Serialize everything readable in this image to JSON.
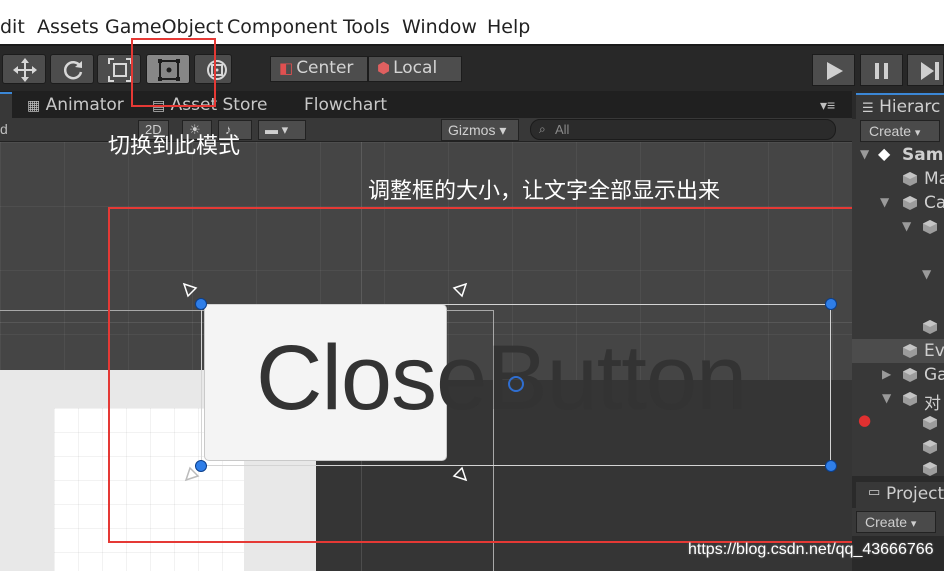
{
  "menu": [
    "dit",
    "Assets",
    "GameObject",
    "Component",
    "Tools",
    "Window",
    "Help"
  ],
  "toolbar": {
    "tools": [
      "move-tool",
      "rotate-tool",
      "scale-tool",
      "rect-tool",
      "transform-tool"
    ],
    "active_tool": "rect-tool",
    "pivot_center": "Center",
    "pivot_local": "Local"
  },
  "tabs": {
    "animator": "Animator",
    "asset_store": "Asset Store",
    "flowchart": "Flowchart"
  },
  "scene_toolbar": {
    "left_stub": "d",
    "mode_2d": "2D",
    "gizmos": "Gizmos",
    "gizmos_arrow": "▾",
    "search_placeholder": "All"
  },
  "scene": {
    "button_text": "CloseButton"
  },
  "annotations": {
    "switch_mode": "切换到此模式",
    "resize_hint": "调整框的大小，让文字全部显示出来"
  },
  "hierarchy": {
    "tab_label": "Hierarc",
    "create_label": "Create",
    "create_arrow": "▾",
    "rows": [
      {
        "label": "Sam",
        "bold": true
      },
      {
        "label": "Ma"
      },
      {
        "label": "Ca"
      },
      {
        "label": ""
      },
      {
        "label": ""
      },
      {
        "label": ""
      },
      {
        "label": ""
      },
      {
        "label": "Ev"
      },
      {
        "label": "Ga"
      },
      {
        "label": "对"
      },
      {
        "label": ""
      },
      {
        "label": ""
      },
      {
        "label": ""
      }
    ]
  },
  "project": {
    "tab_label": "Project",
    "create_label": "Create",
    "create_arrow": "▾"
  },
  "watermark": "https://blog.csdn.net/qq_43666766",
  "colors": {
    "annotation_red": "#e53935",
    "handle_blue": "#2f7ee8",
    "tab_accent": "#3b87d6"
  }
}
